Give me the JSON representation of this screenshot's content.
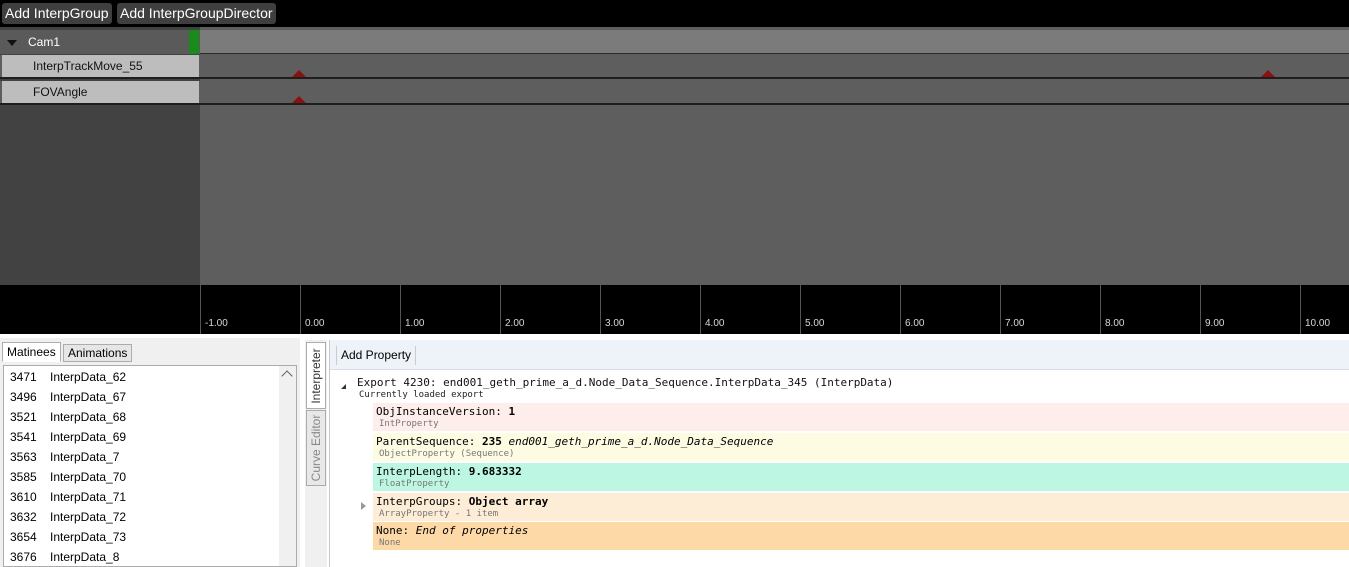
{
  "toolbar": {
    "add_group": "Add InterpGroup",
    "add_director": "Add InterpGroupDirector"
  },
  "timeline": {
    "group_name": "Cam1",
    "tracks": [
      {
        "name": "InterpTrackMove_55"
      },
      {
        "name": "FOVAngle"
      }
    ],
    "ruler_labels": [
      "-1.00",
      "0.00",
      "1.00",
      "2.00",
      "3.00",
      "4.00",
      "5.00",
      "6.00",
      "7.00",
      "8.00",
      "9.00",
      "10.00"
    ],
    "colors": {
      "keyframe": "#8b1010",
      "group_marker": "#1a8a1a"
    }
  },
  "left_panel": {
    "tabs": [
      "Matinees",
      "Animations"
    ],
    "items": [
      {
        "num": "3471",
        "name": "InterpData_62"
      },
      {
        "num": "3496",
        "name": "InterpData_67"
      },
      {
        "num": "3521",
        "name": "InterpData_68"
      },
      {
        "num": "3541",
        "name": "InterpData_69"
      },
      {
        "num": "3563",
        "name": "InterpData_7"
      },
      {
        "num": "3585",
        "name": "InterpData_70"
      },
      {
        "num": "3610",
        "name": "InterpData_71"
      },
      {
        "num": "3632",
        "name": "InterpData_72"
      },
      {
        "num": "3654",
        "name": "InterpData_73"
      },
      {
        "num": "3676",
        "name": "InterpData_8"
      }
    ]
  },
  "vtabs": [
    "Interpreter",
    "Curve Editor"
  ],
  "interpreter": {
    "add_property": "Add Property",
    "export_title": "Export 4230: end001_geth_prime_a_d.Node_Data_Sequence.InterpData_345 (InterpData)",
    "export_sub": "Currently loaded export",
    "props": [
      {
        "label": "ObjInstanceVersion:",
        "value": "1",
        "italic": "",
        "type": "IntProperty",
        "bg": "#fdeeec"
      },
      {
        "label": "ParentSequence:",
        "value": "235",
        "italic": "end001_geth_prime_a_d.Node_Data_Sequence",
        "type": "ObjectProperty (Sequence)",
        "bg": "#fefbe3"
      },
      {
        "label": "InterpLength:",
        "value": "9.683332",
        "italic": "",
        "type": "FloatProperty",
        "bg": "#bdf7e4"
      },
      {
        "label": "InterpGroups:",
        "value": "Object array",
        "italic": "",
        "type": "ArrayProperty - 1 item",
        "bg": "#fdecd6"
      },
      {
        "label": "None:",
        "value": "",
        "italic": "End of properties",
        "type": "None",
        "bg": "#fed9a8"
      }
    ]
  }
}
